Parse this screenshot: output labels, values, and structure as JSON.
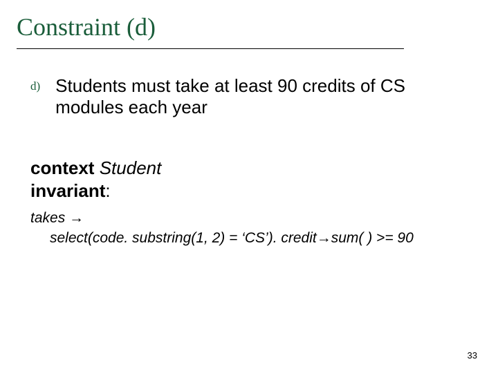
{
  "title": "Constraint (d)",
  "bullet": {
    "marker": "d)",
    "text": "Students must take at least 90 credits of CS modules each year"
  },
  "context": {
    "kw_context": "context",
    "context_name": "Student",
    "kw_invariant": "invariant",
    "colon": ":"
  },
  "expr": {
    "line1_before": "takes ",
    "arrow": "→",
    "line2_before": "select",
    "line2_mid": "(code. substring(1, 2) = ‘CS’). credit",
    "line2_after": "sum( ) >= 90"
  },
  "page_number": "33"
}
